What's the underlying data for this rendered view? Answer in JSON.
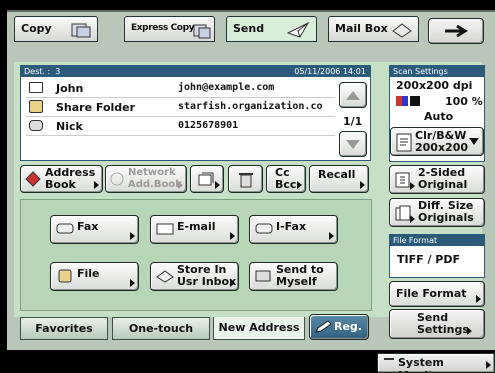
{
  "tabs": [
    {
      "label": "Copy"
    },
    {
      "label": "Express Copy"
    },
    {
      "label": "Send"
    },
    {
      "label": "Mail Box"
    }
  ],
  "header": {
    "dest_label": "Dest. :",
    "dest_count": "3",
    "datetime": "05/11/2006 14:01",
    "page_indicator": "1/1"
  },
  "recipients": [
    {
      "icon": "envelope-icon",
      "name": "John",
      "address": "john@example.com"
    },
    {
      "icon": "folder-icon",
      "name": "Share Folder",
      "address": "starfish.organization.co"
    },
    {
      "icon": "fax-icon",
      "name": "Nick",
      "address": "0125678901"
    }
  ],
  "scan_settings": {
    "title": "Scan Settings",
    "resolution": "200x200 dpi",
    "zoom": "100 %",
    "mode": "Auto",
    "color_mode": "Clr/B&W",
    "color_res": "200x200"
  },
  "toolbar": {
    "address_book": "Address Book",
    "network_address_book": "Network Add.Book",
    "cc_bcc": "Cc Bcc",
    "recall": "Recall"
  },
  "functions": [
    {
      "label": "Fax"
    },
    {
      "label": "E-mail"
    },
    {
      "label": "I-Fax"
    },
    {
      "label": "File"
    },
    {
      "label": "Store In Usr Inbox"
    },
    {
      "label": "Send to Myself"
    }
  ],
  "side": {
    "two_sided": "2-Sided Original",
    "diff_size": "Diff. Size Originals",
    "file_format_title": "File Format",
    "file_format_value": "TIFF / PDF",
    "file_format_btn": "File Format",
    "send_settings": "Send Settings"
  },
  "bottom_tabs": {
    "favorites": "Favorites",
    "one_touch": "One-touch",
    "new_address": "New Address",
    "reg": "Reg."
  },
  "status": {
    "system_monitor": "System Monitor"
  }
}
